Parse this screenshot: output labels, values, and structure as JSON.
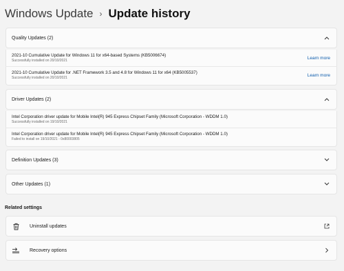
{
  "breadcrumb": {
    "parent": "Windows Update",
    "separator": "›",
    "current": "Update history"
  },
  "sections": {
    "quality": {
      "label": "Quality Updates (2)",
      "expanded": true,
      "items": [
        {
          "title": "2021-10 Cumulative Update for Windows 11 for x64-based Systems (KB5006674)",
          "status": "Successfully installed on 20/10/2021",
          "link": "Learn more"
        },
        {
          "title": "2021-10 Cumulative Update for .NET Framework 3.5 and 4.8 for Windows 11 for x64 (KB5005537)",
          "status": "Successfully installed on 20/10/2021",
          "link": "Learn more"
        }
      ]
    },
    "driver": {
      "label": "Driver Updates (2)",
      "expanded": true,
      "items": [
        {
          "title": "Intel Corporation driver update for Mobile Intel(R) 945 Express Chipset Family (Microsoft Corporation - WDDM 1.0)",
          "status": "Successfully installed on 19/10/2021"
        },
        {
          "title": "Intel Corporation driver update for Mobile Intel(R) 945 Express Chipset Family (Microsoft Corporation - WDDM 1.0)",
          "status": "Failed to install on 19/10/2021 - 0x80003805"
        }
      ]
    },
    "definition": {
      "label": "Definition Updates (3)",
      "expanded": false
    },
    "other": {
      "label": "Other Updates (1)",
      "expanded": false
    }
  },
  "related": {
    "title": "Related settings",
    "uninstall": {
      "label": "Uninstall updates",
      "icon": "trash-icon",
      "trailing_icon": "external-link-icon"
    },
    "recovery": {
      "label": "Recovery options",
      "icon": "recovery-icon",
      "trailing_icon": "chevron-right-icon"
    }
  },
  "colors": {
    "background": "#f3f3f3",
    "card": "#fbfbfb",
    "link": "#0a5aab"
  }
}
